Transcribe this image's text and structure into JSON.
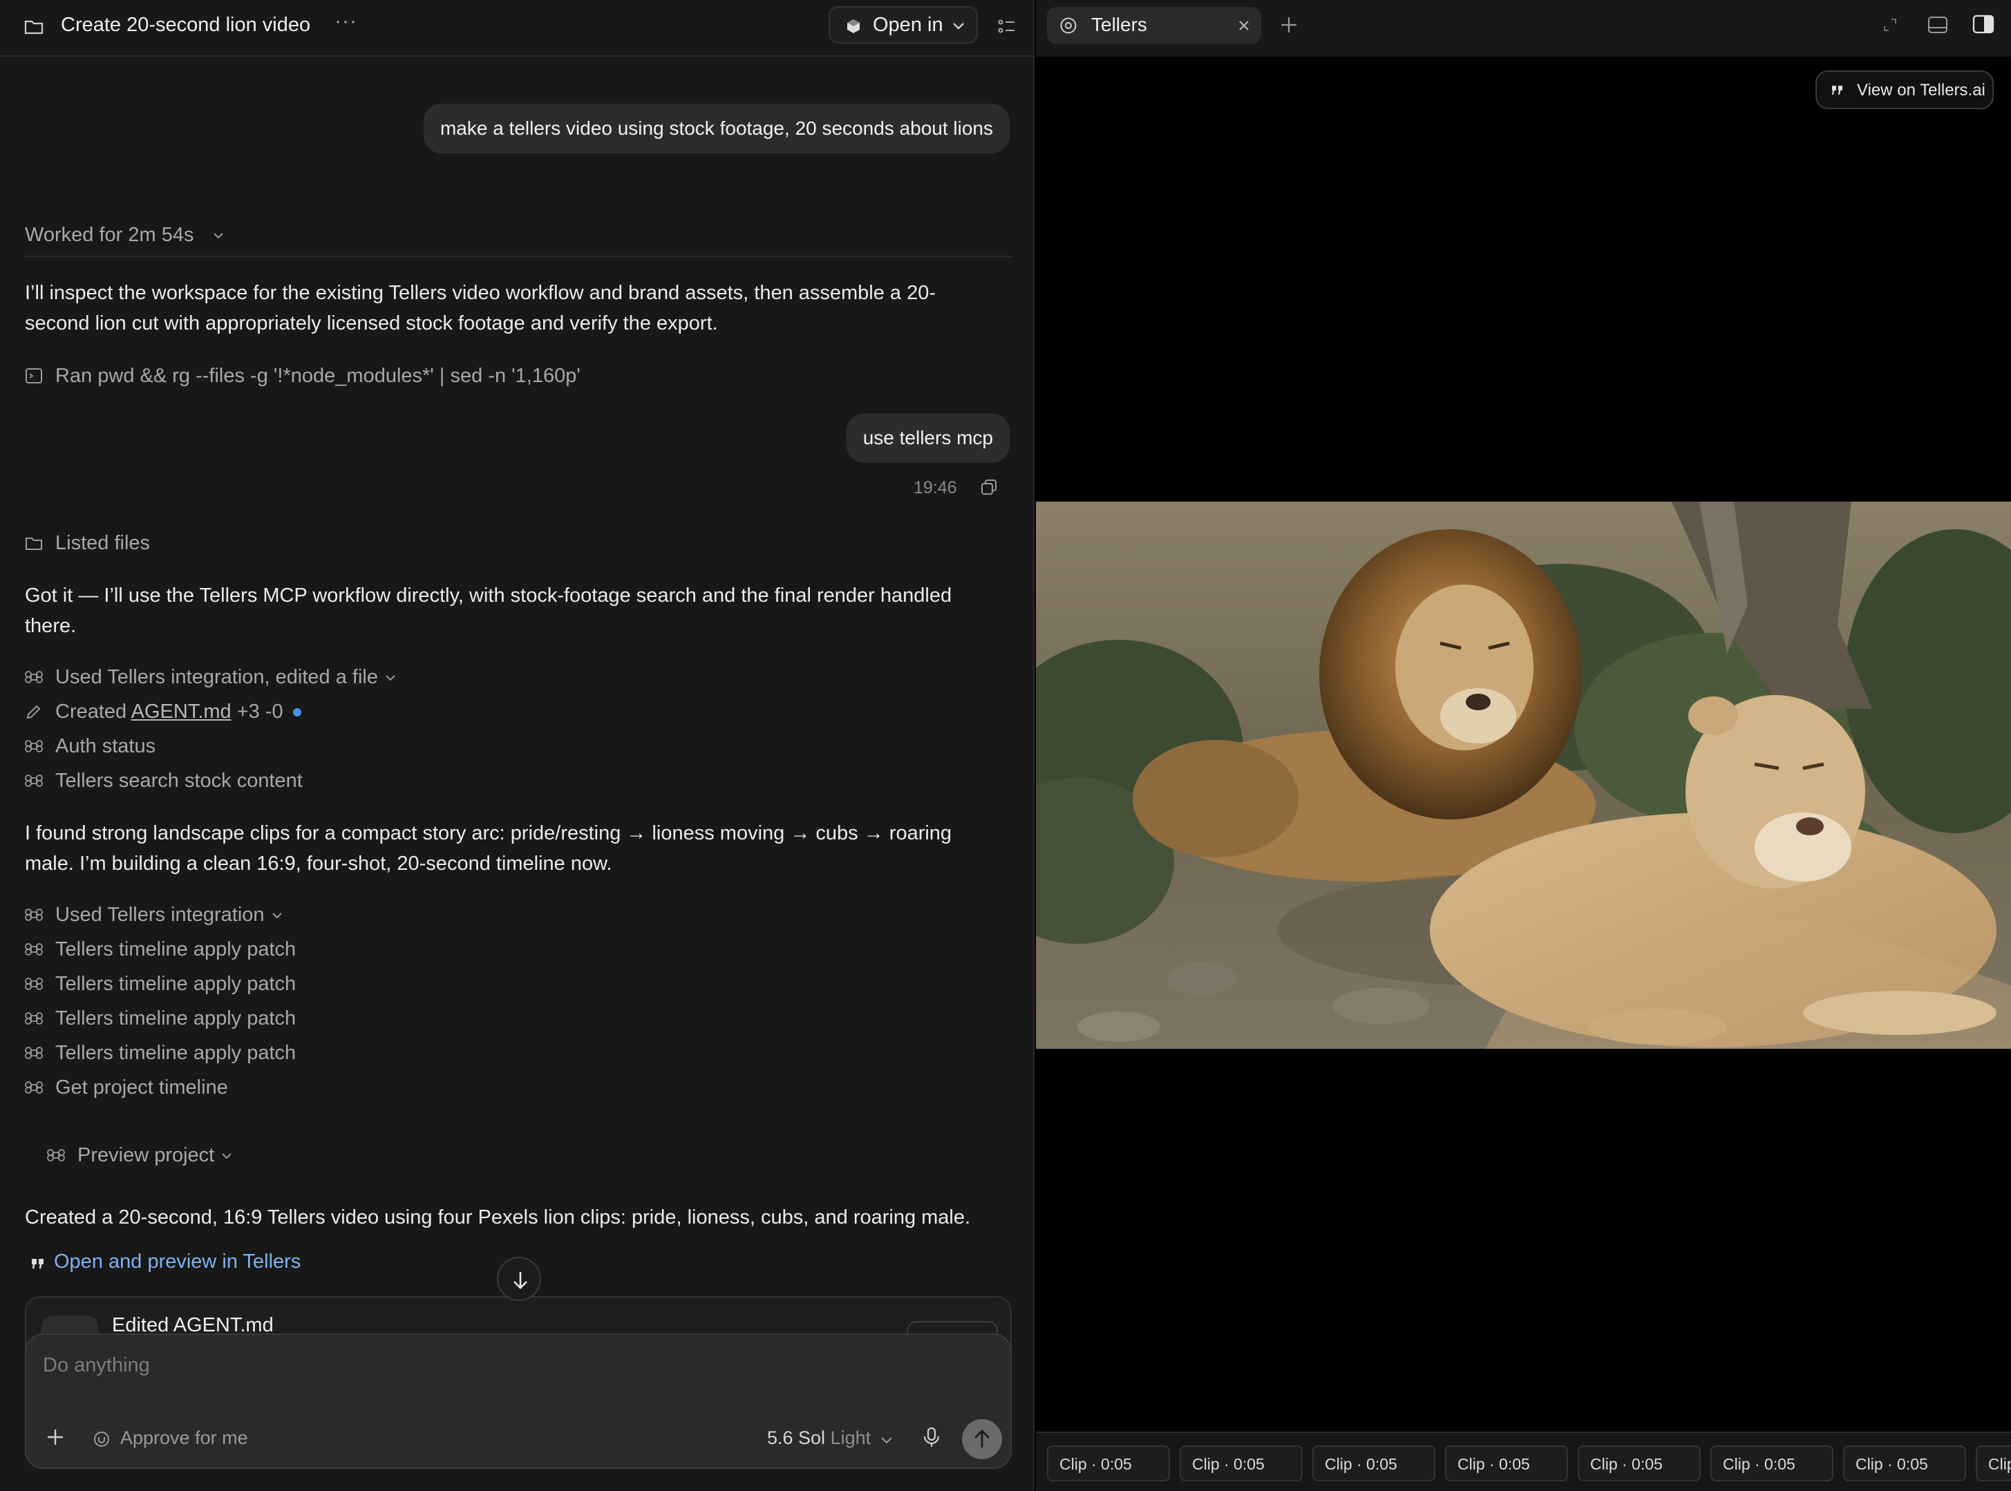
{
  "left": {
    "title": "Create 20-second lion video",
    "more": "···",
    "open_in": "Open in"
  },
  "chat": {
    "msg1": "make a tellers video using stock footage, 20 seconds about lions",
    "worked": "Worked for 2m 54s",
    "para1_l1": "I’ll inspect the workspace for the existing Tellers video workflow and brand assets, then assemble a 20-",
    "para1_l2": "second lion cut with appropriately licensed stock footage and verify the export.",
    "ran": "Ran pwd && rg --files -g '!*node_modules*' | sed -n '1,160p'",
    "msg2": "use tellers mcp",
    "time": "19:46",
    "listed": "Listed files",
    "para2_l1": "Got it — I’ll use the Tellers MCP workflow directly, with stock-footage search and the final render handled",
    "para2_l2": "there.",
    "used1": "Used Tellers integration, edited a file",
    "created_prefix": "Created",
    "created_file": "AGENT.md",
    "created_diff": "+3 -0",
    "auth": "Auth status",
    "search": "Tellers search stock content",
    "para3_l1": "I found strong landscape clips for a compact story arc: pride/resting → lioness moving → cubs → roaring",
    "para3_l2": "male. I’m building a clean 16:9, four-shot, 20-second timeline now.",
    "used2": "Used Tellers integration",
    "patch1": "Tellers timeline apply patch",
    "patch2": "Tellers timeline apply patch",
    "patch3": "Tellers timeline apply patch",
    "patch4": "Tellers timeline apply patch",
    "get_timeline": "Get project timeline",
    "preview": "Preview project",
    "para4": "Created a 20-second, 16:9 Tellers video using four Pexels lion clips: pride, lioness, cubs, and roaring male.",
    "open_link": "Open and preview in Tellers",
    "edited": "Edited AGENT.md"
  },
  "composer": {
    "placeholder": "Do anything",
    "approve": "Approve for me",
    "model": "5.6 Sol",
    "model_mode": "Light"
  },
  "right": {
    "tab": "Tellers",
    "view_on": "View on Tellers.ai",
    "clips": [
      "Clip · 0:05",
      "Clip · 0:05",
      "Clip · 0:05",
      "Clip · 0:05",
      "Clip · 0:05",
      "Clip · 0:05",
      "Clip · 0:05",
      "Clip"
    ]
  },
  "colors": {
    "accent_link": "#7fb2f0",
    "dot": "#4a8ef0",
    "bg": "#181818"
  }
}
